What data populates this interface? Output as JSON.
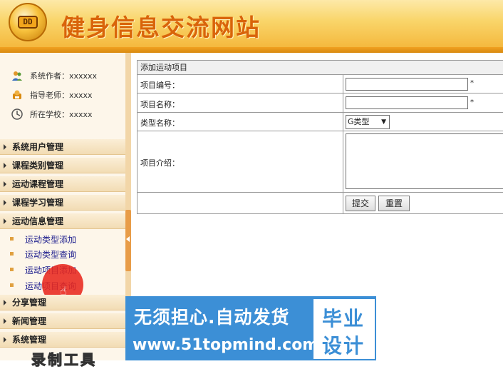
{
  "header": {
    "logo_text": "DD",
    "title": "健身信息交流网站"
  },
  "sidebar": {
    "info": [
      {
        "icon": "users-icon",
        "text": "系统作者：xxxxxx"
      },
      {
        "icon": "teacher-icon",
        "text": "指导老师：xxxxx"
      },
      {
        "icon": "school-icon",
        "text": "所在学校：xxxxx"
      }
    ],
    "menus": [
      {
        "label": "系统用户管理"
      },
      {
        "label": "课程类别管理"
      },
      {
        "label": "运动课程管理"
      },
      {
        "label": "课程学习管理"
      },
      {
        "label": "运动信息管理"
      },
      {
        "label": "分享管理"
      },
      {
        "label": "新闻管理"
      },
      {
        "label": "系统管理"
      }
    ],
    "submenu": [
      {
        "label": "运动类型添加"
      },
      {
        "label": "运动类型查询"
      },
      {
        "label": "运动项目添加"
      },
      {
        "label": "运动项目查询"
      }
    ],
    "tools_label": "录制工具"
  },
  "form": {
    "title": "添加运动项目",
    "fields": {
      "code": {
        "label": "项目编号：",
        "value": "",
        "required_mark": "*"
      },
      "name": {
        "label": "项目名称：",
        "value": "",
        "required_mark": "*"
      },
      "type": {
        "label": "类型名称：",
        "selected": "G类型"
      },
      "intro": {
        "label": "项目介绍：",
        "value": ""
      }
    },
    "submit_label": "提交",
    "reset_label": "重置"
  },
  "watermark": {
    "line1": "无须担心.自动发货",
    "line2": "www.51topmind.com",
    "box_line1": "毕业",
    "box_line2": "设计"
  },
  "colors": {
    "header_gold": "#f4b437",
    "title_orange": "#d9640a",
    "watermark_blue": "#3c8fd6",
    "click_red": "#e8281e"
  }
}
